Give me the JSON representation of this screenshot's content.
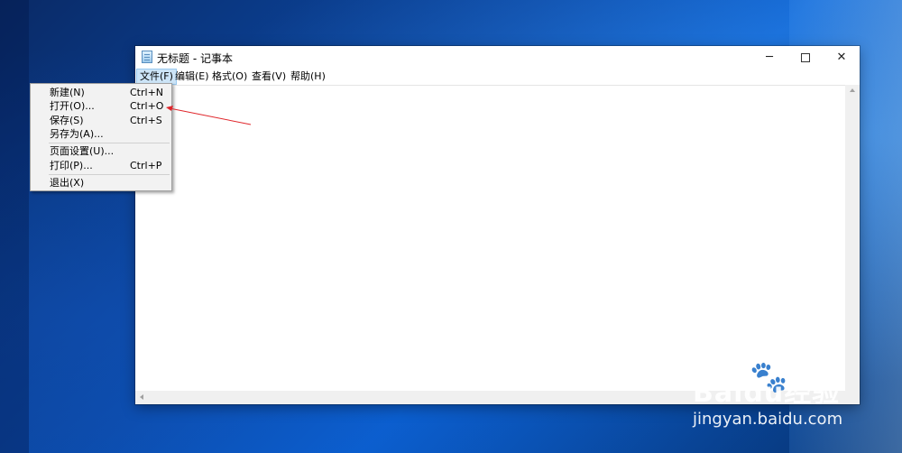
{
  "window": {
    "title": "无标题 - 记事本",
    "controls": {
      "minimize": "─",
      "close": "✕"
    }
  },
  "menubar": {
    "items": [
      "文件(F)",
      "编辑(E)",
      "格式(O)",
      "查看(V)",
      "帮助(H)"
    ],
    "active_index": 0
  },
  "file_menu": {
    "items": [
      {
        "label": "新建(N)",
        "shortcut": "Ctrl+N"
      },
      {
        "label": "打开(O)...",
        "shortcut": "Ctrl+O"
      },
      {
        "label": "保存(S)",
        "shortcut": "Ctrl+S"
      },
      {
        "label": "另存为(A)...",
        "shortcut": ""
      },
      {
        "label": "页面设置(U)...",
        "shortcut": ""
      },
      {
        "label": "打印(P)...",
        "shortcut": "Ctrl+P"
      },
      {
        "label": "退出(X)",
        "shortcut": ""
      }
    ]
  },
  "editor": {
    "text": ""
  },
  "annotation": {
    "color": "#e0262b",
    "points_to": "打开(O)..."
  },
  "watermark": {
    "brand": "Baidu经验",
    "url": "jingyan.baidu.com"
  },
  "colors": {
    "menu_highlight": "#cce4f7",
    "menu_bg": "#f2f2f2"
  }
}
